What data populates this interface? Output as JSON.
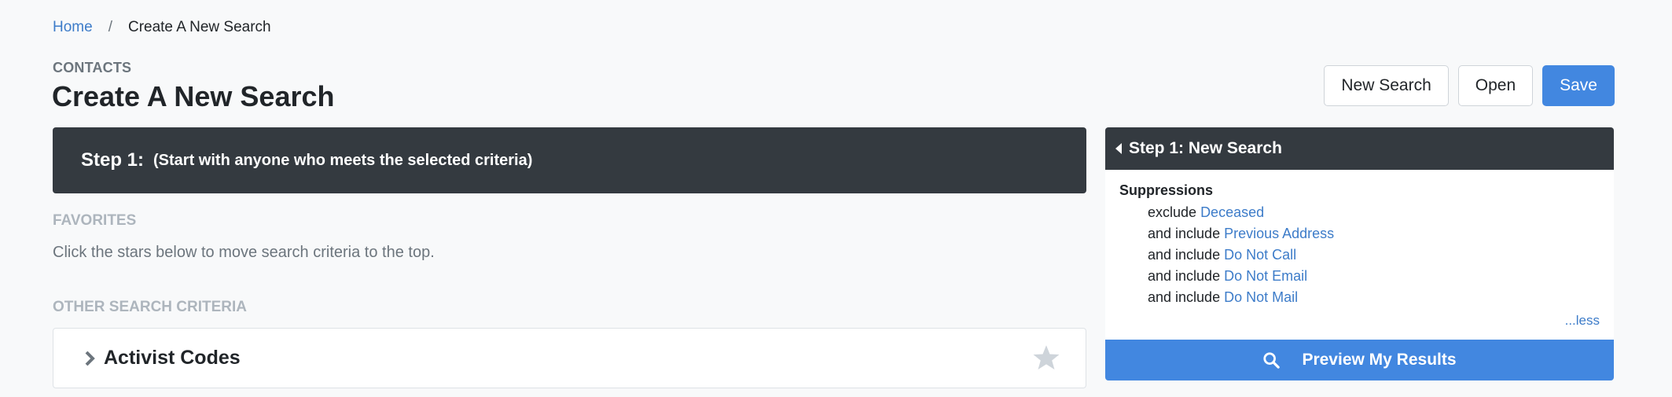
{
  "breadcrumb": {
    "home": "Home",
    "separator": "/",
    "current": "Create A New Search"
  },
  "header": {
    "section": "CONTACTS",
    "title": "Create A New Search",
    "buttons": {
      "new_search": "New Search",
      "open": "Open",
      "save": "Save"
    }
  },
  "step_banner": {
    "title": "Step 1:",
    "description": "(Start with anyone who meets the selected criteria)"
  },
  "favorites": {
    "label": "FAVORITES",
    "help": "Click the stars below to move search criteria to the top."
  },
  "other_criteria": {
    "label": "OTHER SEARCH CRITERIA",
    "items": [
      {
        "title": "Activist Codes",
        "icon": "chevron-right-icon",
        "star_icon": "star-icon"
      }
    ]
  },
  "summary_panel": {
    "header": "Step 1: New Search",
    "group_title": "Suppressions",
    "rules": [
      {
        "verb": "exclude",
        "value": "Deceased"
      },
      {
        "verb": "and include",
        "value": "Previous Address"
      },
      {
        "verb": "and include",
        "value": "Do Not Call"
      },
      {
        "verb": "and include",
        "value": "Do Not Email"
      },
      {
        "verb": "and include",
        "value": "Do Not Mail"
      }
    ],
    "less_link": "...less",
    "preview_button": "Preview My Results"
  },
  "colors": {
    "accent": "#4287e0",
    "dark": "#343a40",
    "link": "#3d7cc9",
    "background": "#f8f9fa"
  }
}
